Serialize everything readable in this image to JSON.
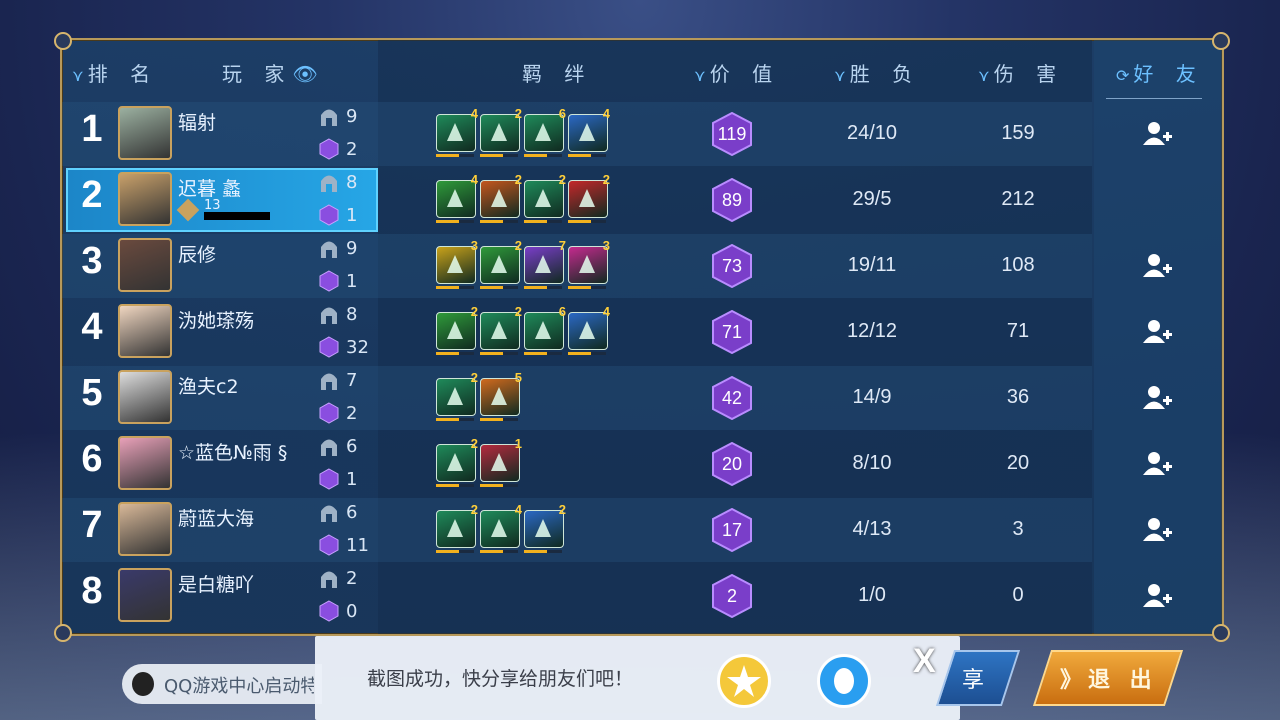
{
  "header": {
    "rank": "排 名",
    "player": "玩 家",
    "bonds": "羁 绊",
    "value": "价 值",
    "winloss": "胜 负",
    "damage": "伤 害",
    "friends": "好 友"
  },
  "players": [
    {
      "rank": "1",
      "name": "辐射",
      "helm": "9",
      "gem": "2",
      "value": "119",
      "wl": "24/10",
      "dmg": "159",
      "friend": true,
      "bonds": [
        {
          "c": "4",
          "color": "#1f8a5a",
          "icon": "tower-icon"
        },
        {
          "c": "2",
          "color": "#1f8a5a",
          "icon": "skull-icon"
        },
        {
          "c": "6",
          "color": "#1f8a5a",
          "icon": "arrow-icon"
        },
        {
          "c": "4",
          "color": "#2b68c4",
          "icon": "rider-icon"
        }
      ]
    },
    {
      "rank": "2",
      "name": "迟暮 蠡",
      "sub": "13",
      "helm": "8",
      "gem": "1",
      "value": "89",
      "wl": "29/5",
      "dmg": "212",
      "friend": false,
      "selected": true,
      "bonds": [
        {
          "c": "4",
          "color": "#2f9a3a",
          "icon": "tree-icon"
        },
        {
          "c": "2",
          "color": "#c4561e",
          "icon": "paw-icon"
        },
        {
          "c": "2",
          "color": "#1f8a5a",
          "icon": "golem-icon"
        },
        {
          "c": "2",
          "color": "#c4282a",
          "icon": "swirl-icon"
        }
      ]
    },
    {
      "rank": "3",
      "name": "辰修",
      "helm": "9",
      "gem": "1",
      "value": "73",
      "wl": "19/11",
      "dmg": "108",
      "friend": true,
      "bonds": [
        {
          "c": "3",
          "color": "#c9a21a",
          "icon": "gear-icon"
        },
        {
          "c": "2",
          "color": "#2f9a3a",
          "icon": "tree-icon"
        },
        {
          "c": "7",
          "color": "#7a3ec9",
          "icon": "mage-icon"
        },
        {
          "c": "3",
          "color": "#c42a8e",
          "icon": "staff-icon"
        }
      ]
    },
    {
      "rank": "4",
      "name": "沩她瑹殇",
      "helm": "8",
      "gem": "32",
      "value": "71",
      "wl": "12/12",
      "dmg": "71",
      "friend": true,
      "bonds": [
        {
          "c": "2",
          "color": "#2f9a3a",
          "icon": "tree-icon"
        },
        {
          "c": "2",
          "color": "#1f8a5a",
          "icon": "tower-icon"
        },
        {
          "c": "6",
          "color": "#1f8a5a",
          "icon": "arrow-icon"
        },
        {
          "c": "4",
          "color": "#2b68c4",
          "icon": "rider-icon"
        }
      ]
    },
    {
      "rank": "5",
      "name": "渔夫c2",
      "helm": "7",
      "gem": "2",
      "value": "42",
      "wl": "14/9",
      "dmg": "36",
      "friend": true,
      "bonds": [
        {
          "c": "2",
          "color": "#1f8a5a",
          "icon": "skull-icon"
        },
        {
          "c": "5",
          "color": "#d06a1e",
          "icon": "sword-icon"
        }
      ]
    },
    {
      "rank": "6",
      "name": "☆蓝色№雨 §",
      "helm": "6",
      "gem": "1",
      "value": "20",
      "wl": "8/10",
      "dmg": "20",
      "friend": true,
      "bonds": [
        {
          "c": "2",
          "color": "#1f8a5a",
          "icon": "tower-icon"
        },
        {
          "c": "1",
          "color": "#b42a3e",
          "icon": "demon-icon"
        }
      ]
    },
    {
      "rank": "7",
      "name": "蔚蓝大海",
      "helm": "6",
      "gem": "11",
      "value": "17",
      "wl": "4/13",
      "dmg": "3",
      "friend": true,
      "bonds": [
        {
          "c": "2",
          "color": "#1f8a5a",
          "icon": "tower-icon"
        },
        {
          "c": "4",
          "color": "#1f8a5a",
          "icon": "arrow-icon"
        },
        {
          "c": "2",
          "color": "#2b68c4",
          "icon": "rider-icon"
        }
      ]
    },
    {
      "rank": "8",
      "name": "是白糖吖",
      "helm": "2",
      "gem": "0",
      "value": "2",
      "wl": "1/0",
      "dmg": "0",
      "friend": true,
      "bonds": []
    }
  ],
  "toast": {
    "text": "截图成功，快分享给朋友们吧！",
    "close": "X"
  },
  "bottom": {
    "qq_text": "QQ游戏中心启动特权",
    "share": "享",
    "exit": "》退 出"
  },
  "colors": {
    "accent": "#6cc0ff",
    "gold": "#f2b11e",
    "hex": "#7a3ec9"
  }
}
